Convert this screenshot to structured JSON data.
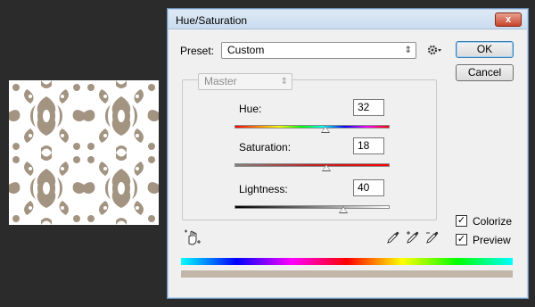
{
  "dialog": {
    "title": "Hue/Saturation",
    "close_label": "x"
  },
  "preset": {
    "label": "Preset:",
    "value": "Custom"
  },
  "buttons": {
    "ok": "OK",
    "cancel": "Cancel"
  },
  "channel": {
    "value": "Master"
  },
  "adjustments": {
    "hue": {
      "label": "Hue:",
      "value": "32",
      "level": 32,
      "min": -180,
      "max": 180
    },
    "saturation": {
      "label": "Saturation:",
      "value": "18",
      "level": 18,
      "min": -100,
      "max": 100
    },
    "lightness": {
      "label": "Lightness:",
      "value": "40",
      "level": 40,
      "min": -100,
      "max": 100
    }
  },
  "options": {
    "colorize_label": "Colorize",
    "colorize_checked": true,
    "preview_label": "Preview",
    "preview_checked": true
  },
  "icons": {
    "gear": "gear-icon",
    "hand": "hand-adjust-icon",
    "eyedropper": "eyedropper-icon",
    "eyedropper_plus": "eyedropper-plus-icon",
    "eyedropper_minus": "eyedropper-minus-icon"
  },
  "colors": {
    "damask": "#a39482",
    "result_bar": "#c1b6a7"
  }
}
